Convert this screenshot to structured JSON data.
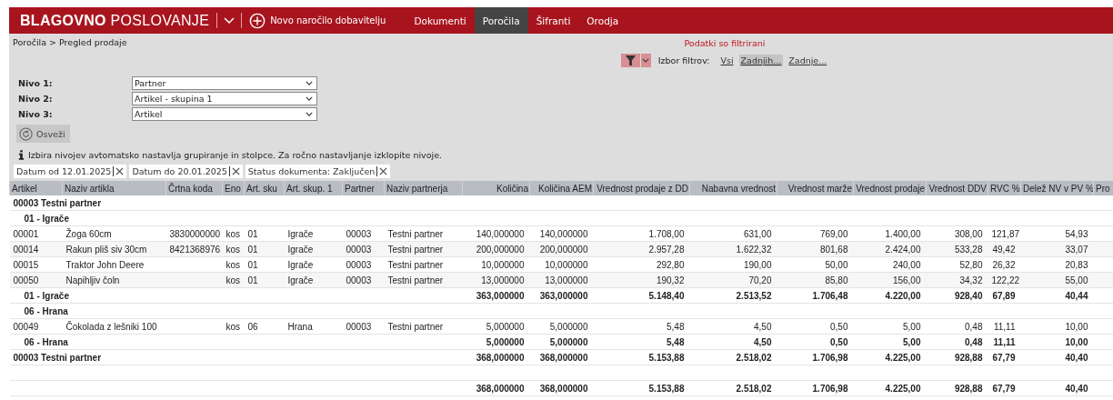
{
  "header": {
    "brand": "**BLAGOVNO** POSLOVANJE",
    "new_order": "Novo naročilo dobavitelju",
    "tabs": [
      {
        "label": "Dokumenti",
        "selected": false
      },
      {
        "label": "Poročila",
        "selected": true
      },
      {
        "label": "Šifranti",
        "selected": false
      },
      {
        "label": "Orodja",
        "selected": false
      }
    ]
  },
  "breadcrumb": "Poročila > Pregled prodaje",
  "filter_notice": "Podatki so filtrirani",
  "filter_picker": {
    "label": "Izbor filtrov:",
    "options": [
      {
        "label": "Vsi",
        "selected": false
      },
      {
        "label": "Zadnjih...",
        "selected": true
      },
      {
        "label": "Zadnje...",
        "selected": false
      }
    ]
  },
  "levels": [
    {
      "label": "Nivo 1:",
      "value": "Partner"
    },
    {
      "label": "Nivo 2:",
      "value": "Artikel - skupina 1"
    },
    {
      "label": "Nivo 3:",
      "value": "Artikel"
    }
  ],
  "refresh_button": "Osveži",
  "info": "Izbira nivojev avtomatsko nastavlja grupiranje in stolpce. Za ročno nastavljanje izklopite nivoje.",
  "active_filters": [
    "Datum od 12.01.2025",
    "Datum do 20.01.2025",
    "Status dokumenta: Zaključen"
  ],
  "table": {
    "columns": [
      "Artikel",
      "Naziv artikla",
      "Črtna koda",
      "Eno",
      "Art. sku",
      "Art. skup. 1",
      "Partner",
      "Naziv partnerja",
      "Količina",
      "Količina AEM",
      "Vrednost prodaje z DD",
      "Nabavna vrednost",
      "Vrednost marže",
      "Vrednost prodaje",
      "Vrednost DDV",
      "RVC %",
      "Delež NV v PV %",
      "Pro"
    ],
    "groups": [
      {
        "label": "00003 Testni partner",
        "children": [
          {
            "label": "01 - Igrače",
            "rows": [
              [
                "00001",
                "Žoga 60cm",
                "3830000000",
                "kos",
                "01",
                "Igrače",
                "00003",
                "Testni partner",
                "140,000000",
                "140,000000",
                "1.708,00",
                "631,00",
                "769,00",
                "1.400,00",
                "308,00",
                "121,87",
                "54,93"
              ],
              [
                "00014",
                "Rakun pliš siv 30cm",
                "8421368976",
                "kos",
                "01",
                "Igrače",
                "00003",
                "Testni partner",
                "200,000000",
                "200,000000",
                "2.957,28",
                "1.622,32",
                "801,68",
                "2.424,00",
                "533,28",
                "49,42",
                "33,07"
              ],
              [
                "00015",
                "Traktor John Deere",
                null,
                "kos",
                "01",
                "Igrače",
                "00003",
                "Testni partner",
                "10,000000",
                "10,000000",
                "292,80",
                "190,00",
                "50,00",
                "240,00",
                "52,80",
                "26,32",
                "20,83"
              ],
              [
                "00050",
                "Napihljiv čoln",
                null,
                "kos",
                "01",
                "Igrače",
                "00003",
                "Testni partner",
                "13,000000",
                "13,000000",
                "190,32",
                "70,20",
                "85,80",
                "156,00",
                "34,32",
                "122,22",
                "55,00"
              ]
            ],
            "footer_label": "01 - Igrače",
            "totals": [
              "363,000000",
              "363,000000",
              "5.148,40",
              "2.513,52",
              "1.706,48",
              "4.220,00",
              "928,40",
              "67,89",
              "40,44"
            ]
          },
          {
            "label": "06 - Hrana",
            "rows": [
              [
                "00049",
                "Čokolada z lešniki 100",
                null,
                "kos",
                "06",
                "Hrana",
                "00003",
                "Testni partner",
                "5,000000",
                "5,000000",
                "5,48",
                "4,50",
                "0,50",
                "5,00",
                "0,48",
                "11,11",
                "10,00"
              ]
            ],
            "footer_label": "06 - Hrana",
            "totals": [
              "5,000000",
              "5,000000",
              "5,48",
              "4,50",
              "0,50",
              "5,00",
              "0,48",
              "11,11",
              "10,00"
            ]
          }
        ],
        "footer_label": "00003 Testni partner",
        "totals": [
          "368,000000",
          "368,000000",
          "5.153,88",
          "2.518,02",
          "1.706,98",
          "4.225,00",
          "928,88",
          "67,79",
          "40,40"
        ]
      }
    ],
    "grand_totals": [
      "368,000000",
      "368,000000",
      "5.153,88",
      "2.518,02",
      "1.706,98",
      "4.225,00",
      "928,88",
      "67,79",
      "40,40"
    ]
  }
}
